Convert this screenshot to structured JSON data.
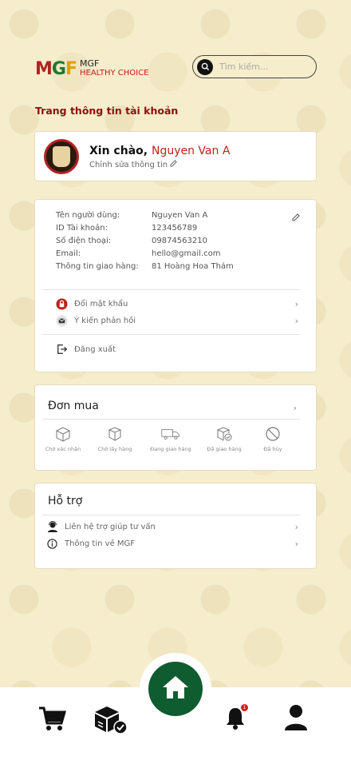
{
  "brand": {
    "mark_m": "M",
    "mark_g": "G",
    "mark_f": "F",
    "line1": "MGF",
    "line2": "HEALTHY CHOICE"
  },
  "search": {
    "placeholder": "Tìm kiếm..."
  },
  "page_title": "Trang thông tin tài khoản",
  "profile": {
    "greeting": "Xin chào,",
    "name": "Nguyen Van A",
    "edit_label": "Chỉnh sửa thông tin"
  },
  "account_info": {
    "rows": [
      {
        "label": "Tên người dùng:",
        "value": "Nguyen Van A"
      },
      {
        "label": "ID Tài khoản:",
        "value": "123456789"
      },
      {
        "label": "Số điện thoại:",
        "value": "09874563210"
      },
      {
        "label": "Email:",
        "value": "hello@gmail.com"
      },
      {
        "label": "Thông tin giao hàng:",
        "value": "81 Hoàng Hoa Thám"
      }
    ]
  },
  "account_menu": {
    "change_password": "Đổi mật khẩu",
    "feedback": "Ý kiến phản hồi",
    "logout": "Đăng xuất"
  },
  "orders": {
    "title": "Đơn mua",
    "statuses": [
      {
        "label": "Chờ xác nhận",
        "icon": "box-open-icon"
      },
      {
        "label": "Chờ lấy hàng",
        "icon": "box-icon"
      },
      {
        "label": "Đang giao hàng",
        "icon": "truck-icon"
      },
      {
        "label": "Đã giao hàng",
        "icon": "box-delivered-icon"
      },
      {
        "label": "Đã hủy",
        "icon": "cancel-icon"
      }
    ]
  },
  "support": {
    "title": "Hỗ trợ",
    "items": [
      {
        "label": "Liên hệ trợ giúp tư vấn",
        "icon": "support-agent-icon"
      },
      {
        "label": "Thông tin về MGF",
        "icon": "info-icon"
      }
    ]
  },
  "bottom_nav": {
    "notification_count": "1",
    "items": [
      "cart-icon",
      "orders-icon",
      "home-icon",
      "bell-icon",
      "user-icon"
    ]
  },
  "colors": {
    "accent": "#c0201c",
    "brand_green": "#0f5c30",
    "background": "#f6edcc"
  }
}
